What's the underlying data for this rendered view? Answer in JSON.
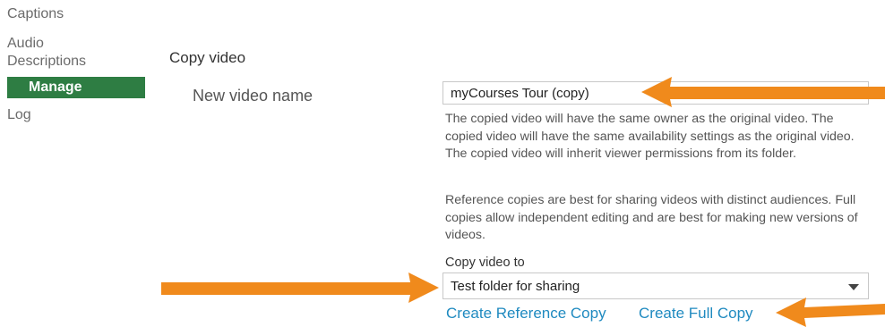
{
  "sidebar": {
    "items": [
      {
        "label": "Captions"
      },
      {
        "label": "Audio"
      },
      {
        "label": "Descriptions"
      },
      {
        "label": "Manage"
      },
      {
        "label": "Log"
      }
    ]
  },
  "main": {
    "section_title": "Copy video",
    "name_label": "New video name",
    "name_value": "myCourses Tour (copy)",
    "help_text_1": "The copied video will have the same owner as the original video. The copied video will have the same availability settings as the original video. The copied video will inherit viewer permissions from its folder.",
    "help_text_2": "Reference copies are best for sharing videos with distinct audiences. Full copies allow independent editing and are best for making new versions of videos.",
    "copy_to_label": "Copy video to",
    "copy_to_value": "Test folder for sharing",
    "create_reference_copy": "Create Reference Copy",
    "create_full_copy": "Create Full Copy"
  },
  "colors": {
    "active_bg": "#2e7d43",
    "link": "#1f8ac0",
    "arrow": "#f08a1c"
  }
}
